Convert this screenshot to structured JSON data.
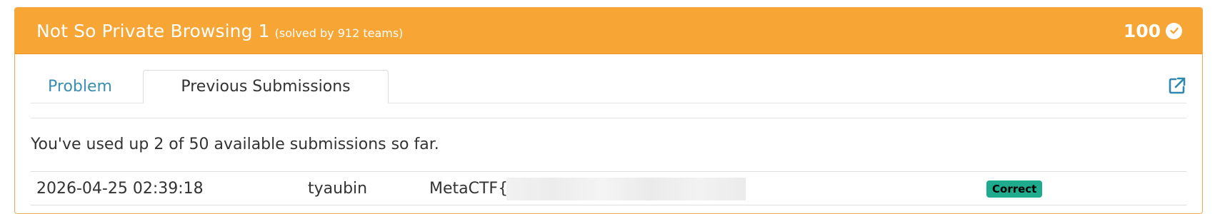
{
  "challenge": {
    "title": "Not So Private Browsing 1",
    "solved_text": "(solved by 912 teams)",
    "points": "100",
    "solved_icon": "check-circle-icon"
  },
  "tabs": [
    {
      "label": "Problem"
    },
    {
      "label": "Previous Submissions"
    }
  ],
  "active_tab": "Previous Submissions",
  "usage_text": "You've used up 2 of 50 available submissions so far.",
  "submissions": [
    {
      "timestamp": "2026-04-25 02:39:18",
      "user": "tyaubin",
      "flag": "MetaCTF{",
      "status": "Correct"
    }
  ],
  "colors": {
    "header": "#f7a535",
    "tab_link": "#3a8eb0",
    "badge": "#1fab8e"
  }
}
